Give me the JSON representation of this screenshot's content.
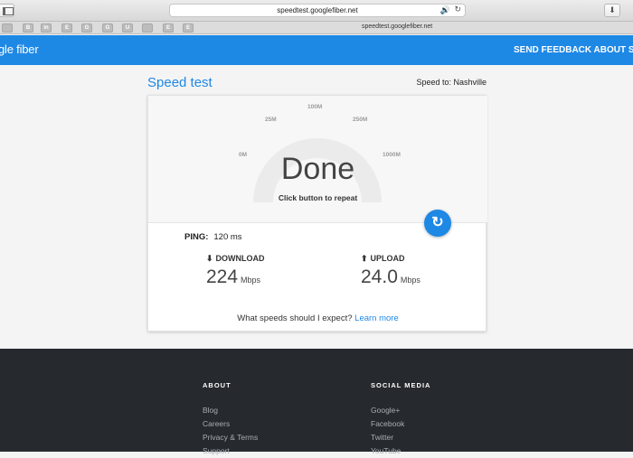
{
  "browser": {
    "url": "speedtest.googlefiber.net",
    "tab_title": "speedtest.googlefiber.net",
    "bookmarks": [
      "",
      "B",
      "in",
      "E",
      "G",
      "G",
      "U",
      "",
      "E",
      "E"
    ]
  },
  "header": {
    "logo": "gle fiber",
    "feedback": "SEND FEEDBACK ABOUT SPE"
  },
  "main": {
    "title": "Speed test",
    "speed_to_label": "Speed to: Nashville",
    "gauge": {
      "ticks": [
        "0M",
        "25M",
        "100M",
        "250M",
        "1000M"
      ],
      "status": "Done",
      "subtitle": "Click button to repeat"
    },
    "ping": {
      "label": "PING:",
      "value": "120 ms"
    },
    "download": {
      "label": "DOWNLOAD",
      "value": "224",
      "unit": "Mbps"
    },
    "upload": {
      "label": "UPLOAD",
      "value": "24.0",
      "unit": "Mbps"
    },
    "expect_text": "What speeds should I expect?",
    "learn_more": "Learn more"
  },
  "footer": {
    "about": {
      "heading": "ABOUT",
      "links": [
        "Blog",
        "Careers",
        "Privacy & Terms",
        "Support"
      ]
    },
    "social": {
      "heading": "SOCIAL MEDIA",
      "links": [
        "Google+",
        "Facebook",
        "Twitter",
        "YouTube"
      ]
    }
  },
  "colors": {
    "accent": "#1e88e5",
    "footer_bg": "#262a2e"
  }
}
